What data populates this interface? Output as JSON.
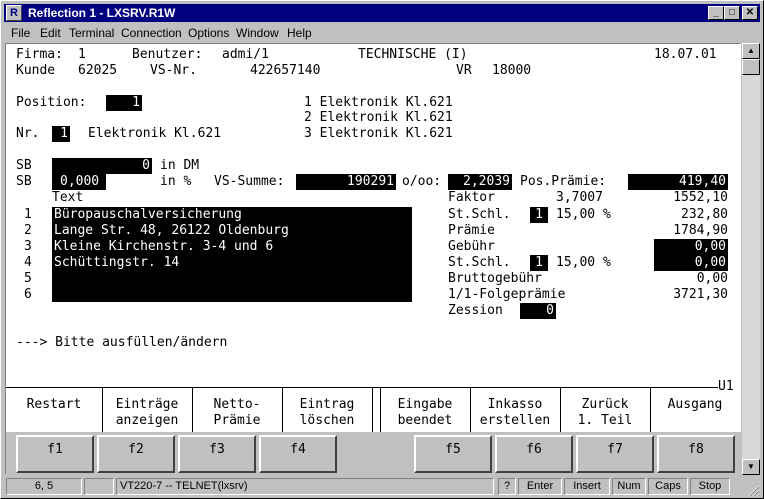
{
  "window": {
    "title": "Reflection 1 - LXSRV.R1W",
    "icon": "reflection-app-icon"
  },
  "titlebar_buttons": {
    "minimize": "_",
    "maximize": "□",
    "close": "✕"
  },
  "menu": [
    "File",
    "Edit",
    "Terminal",
    "Connection",
    "Options",
    "Window",
    "Help"
  ],
  "header": {
    "firma_label": "Firma:",
    "firma": "1",
    "benutzer_label": "Benutzer:",
    "benutzer": "admi/1",
    "system": "TECHNISCHE (I)",
    "date": "18.07.01",
    "kunde_label": "Kunde",
    "kunde": "62025",
    "vsnr_label": "VS-Nr.",
    "vsnr": "422657140",
    "vr_label": "VR",
    "vr": "18000"
  },
  "position": {
    "label": "Position:",
    "value": "1",
    "options": [
      "1 Elektronik Kl.621",
      "2 Elektronik Kl.621",
      "3 Elektronik Kl.621"
    ]
  },
  "nr": {
    "label": "Nr.",
    "value": "1",
    "description": "Elektronik Kl.621"
  },
  "sb1": {
    "label": "SB",
    "value": "0",
    "unit": "in DM"
  },
  "sb2": {
    "label": "SB",
    "value": "0,000",
    "unit": "in %"
  },
  "vssumme": {
    "label": "VS-Summe:",
    "value": "190291"
  },
  "ooo": {
    "label": "o/oo:",
    "value": "2,2039"
  },
  "posprae": {
    "label": "Pos.Prämie:",
    "value": "419,40"
  },
  "text_block": {
    "header": "Text",
    "numbers": [
      "1",
      "2",
      "3",
      "4",
      "5",
      "6"
    ],
    "lines": [
      "Büropauschalversicherung",
      "Lange Str. 48, 26122 Oldenburg",
      "Kleine Kirchenstr. 3-4 und 6",
      "Schüttingstr. 14",
      "",
      ""
    ]
  },
  "calc": {
    "faktor_label": "Faktor",
    "faktor": "3,7007",
    "faktor_result": "1552,10",
    "stschl1_label": "St.Schl.",
    "stschl1_key": "1",
    "stschl1_rate": "15,00 %",
    "stschl1_result": "232,80",
    "praemie_label": "Prämie",
    "praemie": "1784,90",
    "gebuehr_label": "Gebühr",
    "gebuehr": "0,00",
    "stschl2_label": "St.Schl.",
    "stschl2_key": "1",
    "stschl2_rate": "15,00 %",
    "stschl2_result": "0,00",
    "brutto_label": "Bruttogebühr",
    "brutto": "0,00",
    "folge_label": "1/1-Folgeprämie",
    "folge": "3721,30",
    "zession_label": "Zession",
    "zession": "0"
  },
  "message": "---> Bitte ausfüllen/ändern",
  "screen_id": "U1",
  "function_labels": [
    "Restart",
    "Einträge\nanzeigen",
    "Netto-\nPrämie",
    "Eintrag\nlöschen",
    "Eingabe\nbeendet",
    "Inkasso\nerstellen",
    "Zurück\n1. Teil",
    "Ausgang"
  ],
  "function_keys": [
    "f1",
    "f2",
    "f3",
    "f4",
    "f5",
    "f6",
    "f7",
    "f8"
  ],
  "status": {
    "cursor": "6, 5",
    "blank": "",
    "session": "VT220-7 -- TELNET(lxsrv)",
    "help": "?",
    "keys": [
      "Enter",
      "Insert",
      "Num",
      "Caps",
      "Stop"
    ]
  }
}
